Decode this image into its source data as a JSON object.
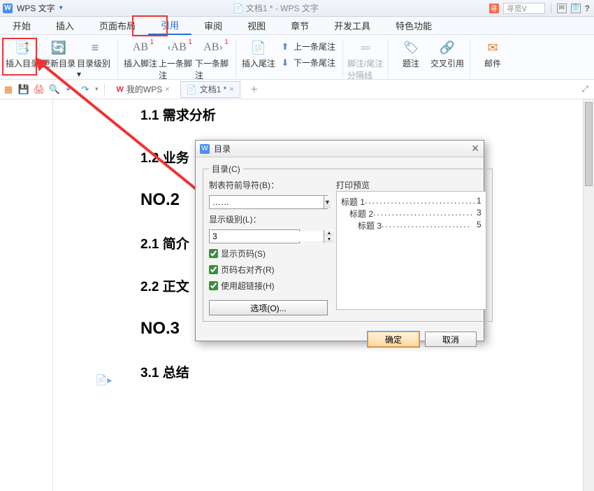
{
  "titlebar": {
    "app_name": "WPS 文字",
    "doc_title": "文档1 * - WPS 文字",
    "search_placeholder": "寻觅V",
    "icon_text": "W"
  },
  "tabs": {
    "start": "开始",
    "insert": "插入",
    "page_layout": "页面布局",
    "references": "引用",
    "review": "审阅",
    "view": "视图",
    "chapter": "章节",
    "dev_tools": "开发工具",
    "special": "特色功能"
  },
  "ribbon": {
    "insert_toc": "插入目录",
    "update_toc": "更新目录",
    "toc_level": "目录级别",
    "insert_footnote": "插入脚注",
    "prev_footnote": "上一条脚注",
    "next_footnote": "下一条脚注",
    "insert_endnote": "插入尾注",
    "prev_endnote": "上一条尾注",
    "next_endnote": "下一条尾注",
    "separator": "脚注/尾注分隔线",
    "caption": "题注",
    "cross_ref": "交叉引用",
    "mail": "邮件"
  },
  "doctabs": {
    "my_wps": "我的WPS",
    "doc1": "文档1 *"
  },
  "document": {
    "h1": "1.1 需求分析",
    "h2": "1.2 业务",
    "no2": "NO.2",
    "h3": "2.1 简介",
    "h4": "2.2 正文",
    "no3": "NO.3",
    "h5": "3.1 总结"
  },
  "dialog": {
    "title": "目录",
    "group_label": "目录(C)",
    "tab_leader_label": "制表符前导符(B)：",
    "tab_leader_value": "……",
    "show_level_label": "显示级别(L)：",
    "show_level_value": "3",
    "chk_show_page": "显示页码(S)",
    "chk_right_align": "页码右对齐(R)",
    "chk_hyperlink": "使用超链接(H)",
    "options_btn": "选项(O)...",
    "preview_label": "打印预览",
    "preview": {
      "l1_text": "标题 1",
      "l1_page": "1",
      "l2_text": "标题 2",
      "l2_page": "3",
      "l3_text": "标题 3",
      "l3_page": "5"
    },
    "ok": "确定",
    "cancel": "取消"
  }
}
